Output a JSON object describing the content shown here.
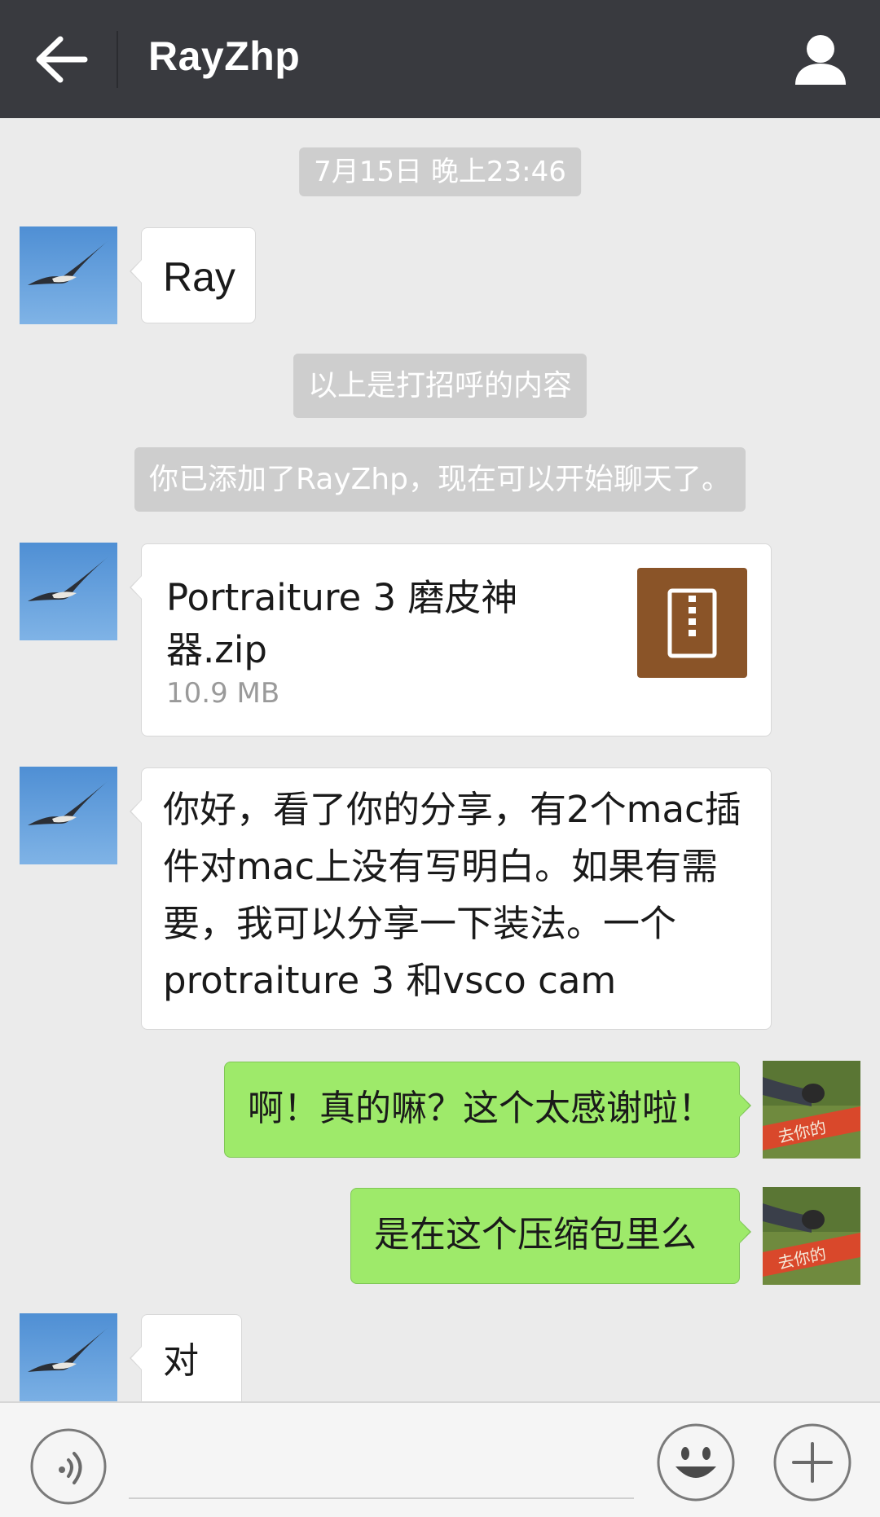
{
  "header": {
    "title": "RayZhp",
    "back_icon": "arrow-left-icon",
    "profile_icon": "person-icon"
  },
  "colors": {
    "header_bg": "#393a3f",
    "chat_bg": "#ebebeb",
    "sent_bubble": "#9eea6a",
    "received_bubble": "#ffffff",
    "file_icon_bg": "#8a5428"
  },
  "messages": {
    "timestamp": "7月15日 晚上23:46",
    "m1": "Ray",
    "sys_greeting": "以上是打招呼的内容",
    "sys_added": "你已添加了RayZhp，现在可以开始聊天了。",
    "file": {
      "name": "Portraiture 3 磨皮神器.zip",
      "size": "10.9 MB",
      "icon": "zip-file-icon"
    },
    "m3": "你好，看了你的分享，有2个mac插件对mac上没有写明白。如果有需要，我可以分享一下装法。一个protraiture 3 和vsco cam",
    "m4": "啊！真的嘛？这个太感谢啦！",
    "m5": "是在这个压缩包里么",
    "m6": "对"
  },
  "input_bar": {
    "voice_icon": "voice-icon",
    "emoji_icon": "emoji-icon",
    "plus_icon": "plus-icon"
  }
}
